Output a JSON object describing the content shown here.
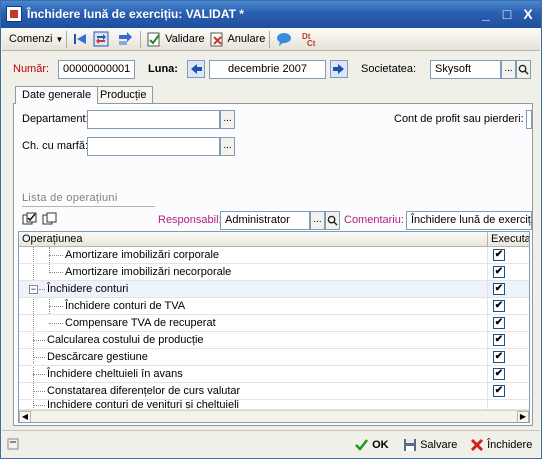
{
  "window": {
    "title": "Închidere lună de exercițiu: VALIDAT *",
    "controls": {
      "minimize": "_",
      "maximize": "□",
      "close": "X"
    }
  },
  "toolbar": {
    "menu_label": "Comenzi",
    "validate_label": "Validare",
    "cancel_label": "Anulare"
  },
  "header": {
    "numar_label": "Număr:",
    "numar_value": "00000000001",
    "luna_label": "Luna:",
    "luna_value": "decembrie 2007",
    "societatea_label": "Societatea:",
    "societatea_value": "Skysoft"
  },
  "tabs": [
    {
      "label": "Date generale",
      "active": true
    },
    {
      "label": "Producție",
      "active": false
    }
  ],
  "general": {
    "departament_label": "Departament:",
    "departament_value": "",
    "marfa_label": "Ch. cu marfă:",
    "marfa_value": "",
    "profit_label": "Cont de profit sau pierderi:"
  },
  "operations": {
    "section_title": "Lista de operațiuni",
    "responsabil_label": "Responsabil:",
    "responsabil_value": "Administrator",
    "comentariu_label": "Comentariu:",
    "comentariu_value": "Închidere lună de exercițiu",
    "columns": [
      "Operațiunea",
      "Executat"
    ],
    "rows": [
      {
        "name": "Amortizare imobilizări corporale",
        "level": 2,
        "checked": true
      },
      {
        "name": "Amortizare imobilizări necorporale",
        "level": 2,
        "checked": true
      },
      {
        "name": "Închidere conturi",
        "level": 1,
        "checked": true,
        "expanded": true
      },
      {
        "name": "Închidere conturi de TVA",
        "level": 2,
        "checked": true
      },
      {
        "name": "Compensare TVA de recuperat",
        "level": 2,
        "checked": true
      },
      {
        "name": "Calcularea costului de producție",
        "level": 1,
        "checked": true
      },
      {
        "name": "Descărcare gestiune",
        "level": 1,
        "checked": true
      },
      {
        "name": "Închidere cheltuieli în avans",
        "level": 1,
        "checked": true
      },
      {
        "name": "Constatarea diferențelor de curs valutar",
        "level": 1,
        "checked": true
      },
      {
        "name": "Închidere conturi de venituri și cheltuieli",
        "level": 1,
        "checked": true
      }
    ]
  },
  "footer": {
    "ok_label": "OK",
    "save_label": "Salvare",
    "close_label": "Închidere"
  },
  "colors": {
    "accent_red": "#c00000",
    "accent_blue": "#1a3fa0",
    "titlebar": "#2a5fb0"
  }
}
